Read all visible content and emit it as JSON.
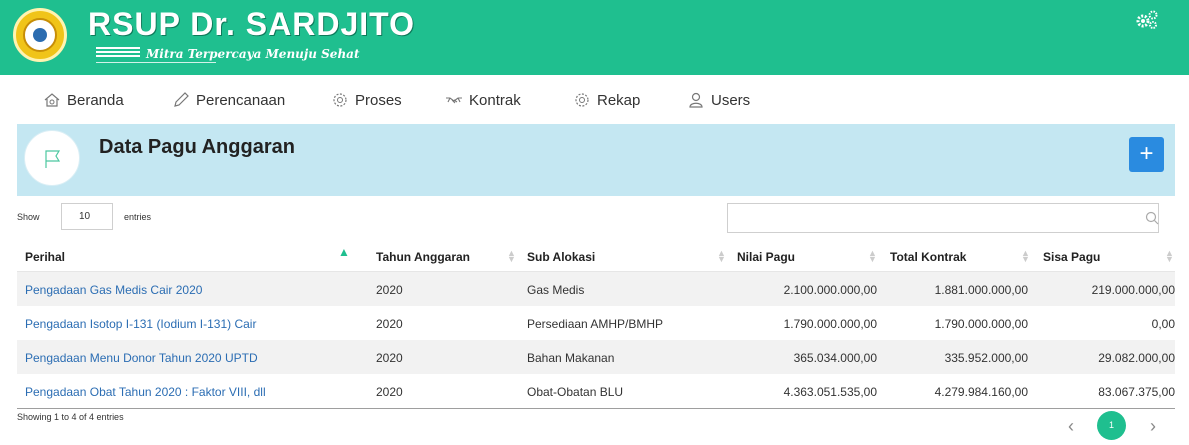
{
  "header": {
    "title": "RSUP Dr. SARDJITO",
    "subtitle": "Mitra Terpercaya Menuju Sehat"
  },
  "nav": {
    "items": [
      {
        "label": "Beranda",
        "icon": "home-icon"
      },
      {
        "label": "Perencanaan",
        "icon": "pencil-icon"
      },
      {
        "label": "Proses",
        "icon": "gear-icon"
      },
      {
        "label": "Kontrak",
        "icon": "handshake-icon"
      },
      {
        "label": "Rekap",
        "icon": "gear-icon"
      },
      {
        "label": "Users",
        "icon": "user-icon"
      }
    ]
  },
  "page": {
    "title": "Data Pagu Anggaran",
    "add_label": "+"
  },
  "controls": {
    "show_label": "Show",
    "entries_value": "10",
    "entries_label": "entries",
    "search_value": ""
  },
  "table": {
    "headers": [
      "Perihal",
      "Tahun Anggaran",
      "Sub Alokasi",
      "Nilai Pagu",
      "Total Kontrak",
      "Sisa Pagu"
    ],
    "rows": [
      [
        "Pengadaan Gas Medis Cair 2020",
        "2020",
        "Gas Medis",
        "2.100.000.000,00",
        "1.881.000.000,00",
        "219.000.000,00"
      ],
      [
        "Pengadaan Isotop I-131 (Iodium I-131) Cair",
        "2020",
        "Persediaan AMHP/BMHP",
        "1.790.000.000,00",
        "1.790.000.000,00",
        "0,00"
      ],
      [
        "Pengadaan Menu Donor Tahun 2020 UPTD",
        "2020",
        "Bahan Makanan",
        "365.034.000,00",
        "335.952.000,00",
        "29.082.000,00"
      ],
      [
        "Pengadaan Obat Tahun 2020 : Faktor VIII, dll",
        "2020",
        "Obat-Obatan BLU",
        "4.363.051.535,00",
        "4.279.984.160,00",
        "83.067.375,00"
      ]
    ]
  },
  "footer": {
    "info": "Showing 1 to 4 of 4 entries",
    "prev": "‹",
    "current_page": "1",
    "next": "›"
  },
  "colors": {
    "header_bg": "#1fbf8f",
    "band_bg": "#c4e7f2",
    "link": "#2b6db3",
    "button": "#2a8be0"
  }
}
